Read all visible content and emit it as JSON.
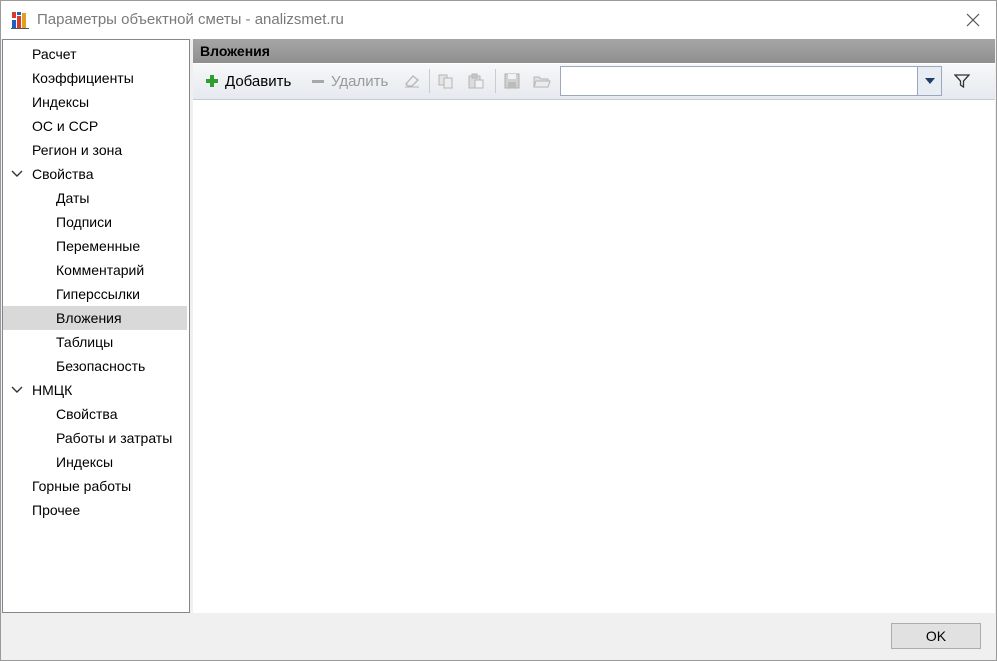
{
  "window": {
    "title": "Параметры объектной сметы - analizsmet.ru"
  },
  "tree": {
    "items": [
      {
        "label": "Расчет",
        "level": 0
      },
      {
        "label": "Коэффициенты",
        "level": 0
      },
      {
        "label": "Индексы",
        "level": 0
      },
      {
        "label": "ОС и ССР",
        "level": 0
      },
      {
        "label": "Регион и зона",
        "level": 0
      },
      {
        "label": "Свойства",
        "level": 0,
        "expanded": true
      },
      {
        "label": "Даты",
        "level": 1
      },
      {
        "label": "Подписи",
        "level": 1
      },
      {
        "label": "Переменные",
        "level": 1
      },
      {
        "label": "Комментарий",
        "level": 1
      },
      {
        "label": "Гиперссылки",
        "level": 1
      },
      {
        "label": "Вложения",
        "level": 1,
        "selected": true
      },
      {
        "label": "Таблицы",
        "level": 1
      },
      {
        "label": "Безопасность",
        "level": 1
      },
      {
        "label": "НМЦК",
        "level": 0,
        "expanded": true
      },
      {
        "label": "Свойства",
        "level": 1
      },
      {
        "label": "Работы и затраты",
        "level": 1
      },
      {
        "label": "Индексы",
        "level": 1
      },
      {
        "label": "Горные работы",
        "level": 0
      },
      {
        "label": "Прочее",
        "level": 0
      }
    ]
  },
  "panel": {
    "title": "Вложения"
  },
  "toolbar": {
    "add_label": "Добавить",
    "delete_label": "Удалить",
    "search_value": "",
    "add_icon": "plus-icon",
    "delete_icon": "minus-icon",
    "filter_icon": "filter-icon"
  },
  "footer": {
    "ok_label": "OK"
  },
  "colors": {
    "selected_item": "#d9d9d9",
    "header_bar": "#999999",
    "add_icon": "#2e9e2e"
  }
}
